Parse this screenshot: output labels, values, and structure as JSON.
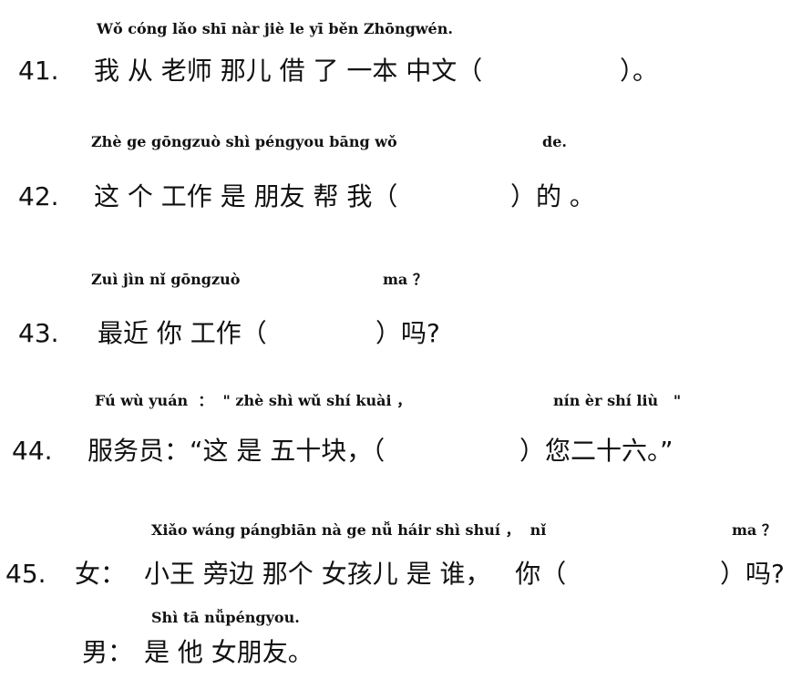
{
  "questions": [
    {
      "number": "41.",
      "pinyin_a": "Wǒ cóng lǎo shī nàr jiè le yī běn Zhōngwén.",
      "chinese_a": "我 从 老师 那儿 借 了 一本 中文（",
      "chinese_b": "）。"
    },
    {
      "number": "42.",
      "pinyin_a": "Zhè ge gōngzuò shì péngyou bāng wǒ",
      "pinyin_b": "de.",
      "chinese_a": "这 个 工作 是 朋友 帮 我（",
      "chinese_b": "）的 。"
    },
    {
      "number": "43.",
      "pinyin_a": "Zuì jìn nǐ gōngzuò",
      "pinyin_b": "ma ？",
      "chinese_a": "最近 你 工作（",
      "chinese_b": "）吗?"
    },
    {
      "number": "44.",
      "pinyin_a": "Fú wù yuán  ：  \" zhè shì wǔ shí kuài ，",
      "pinyin_b": "nín èr shí liù   \"",
      "chinese_a": "服务员：“这 是 五十块，（",
      "chinese_b": "）您二十六。”"
    },
    {
      "number": "45.",
      "pinyin_a": "Xiǎo wáng pángbiān nà ge nǚ háir shì shuí ，  nǐ",
      "pinyin_b": "ma ？",
      "speaker_1": "女：",
      "chinese_a": "小王 旁边 那个 女孩儿 是 谁，   你（",
      "chinese_b": "）吗?",
      "pinyin_c": "Shì tā nǚpéngyou.",
      "speaker_2": "男：",
      "chinese_c": "是 他 女朋友。"
    }
  ]
}
